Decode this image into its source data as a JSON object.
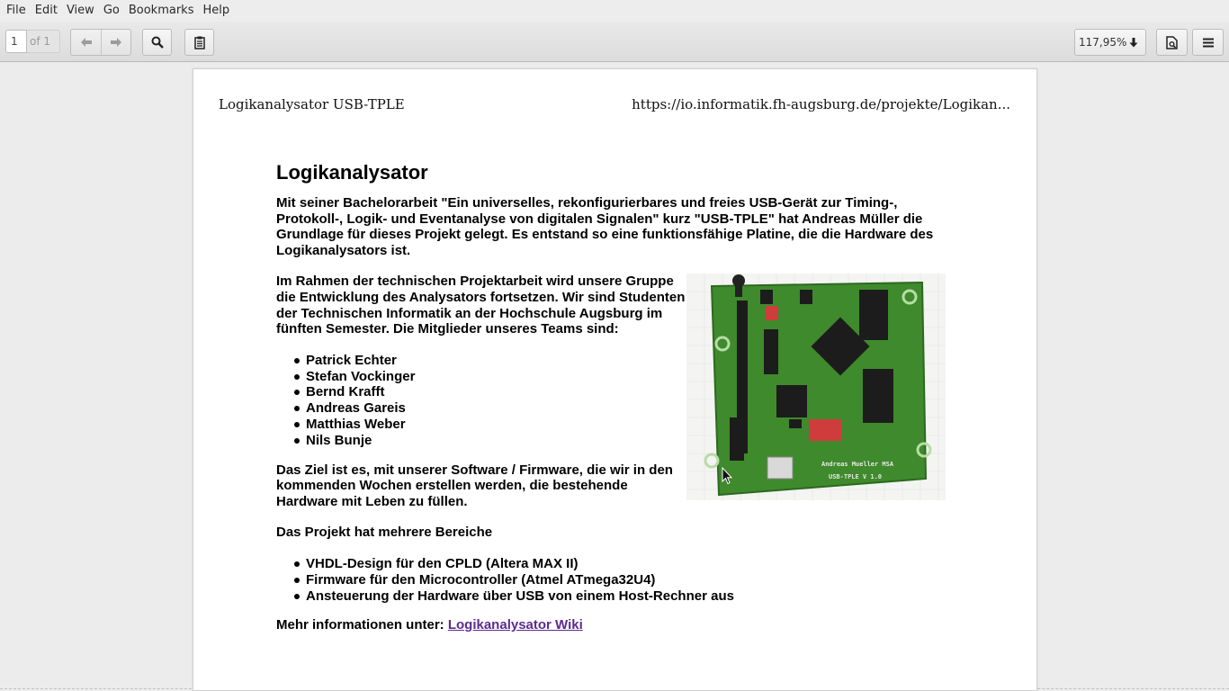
{
  "menu": {
    "items": [
      "File",
      "Edit",
      "View",
      "Go",
      "Bookmarks",
      "Help"
    ]
  },
  "toolbar": {
    "page_number": "1",
    "page_count": "of 1",
    "zoom": "117,95%",
    "icons": [
      "previous-page-icon",
      "next-page-icon",
      "search-icon",
      "notes-icon",
      "document-properties-icon",
      "menu-icon"
    ]
  },
  "document": {
    "header_left": "Logikanalysator USB-TPLE",
    "header_right": "https://io.informatik.fh-augsburg.de/projekte/Logikan...",
    "title": "Logikanalysator",
    "intro": "Mit seiner Bachelorarbeit \"Ein universelles, rekonfigurierbares und freies USB-Gerät zur Timing-, Protokoll-, Logik- und Eventanalyse von digitalen Signalen\" kurz \"USB-TPLE\" hat Andreas Müller die Grundlage für dieses Projekt gelegt. Es entstand so eine funktionsfähige Platine, die die Hardware des Logikanalysators ist.",
    "team_intro": "Im Rahmen der technischen Projektarbeit wird unsere Gruppe die Entwicklung des Analysators fortsetzen. Wir sind Studenten der Technischen Informatik an der Hochschule Augsburg im fünften Semester. Die Mitglieder unseres Teams sind:",
    "members": [
      "Patrick Echter",
      "Stefan Vockinger",
      "Bernd Krafft",
      "Andreas Gareis",
      "Matthias Weber",
      "Nils Bunje"
    ],
    "goal": "Das Ziel ist es, mit unserer Software / Firmware, die wir in den kommenden Wochen erstellen werden, die bestehende Hardware mit Leben zu füllen.",
    "areas_intro": "Das Projekt hat mehrere Bereiche",
    "areas": [
      "VHDL-Design für den CPLD (Altera MAX II)",
      "Firmware für den Microcontroller (Atmel ATmega32U4)",
      "Ansteuerung der Hardware über USB von einem Host-Rechner aus"
    ],
    "more_info_label": "Mehr informationen unter: ",
    "more_info_link": "Logikanalysator Wiki",
    "pcb_silkscreen": "Andreas Mueller MSA USB-TPLE V 1.0"
  },
  "colors": {
    "link": "#5b2c8f",
    "pcb_green": "#3f8a2c"
  }
}
